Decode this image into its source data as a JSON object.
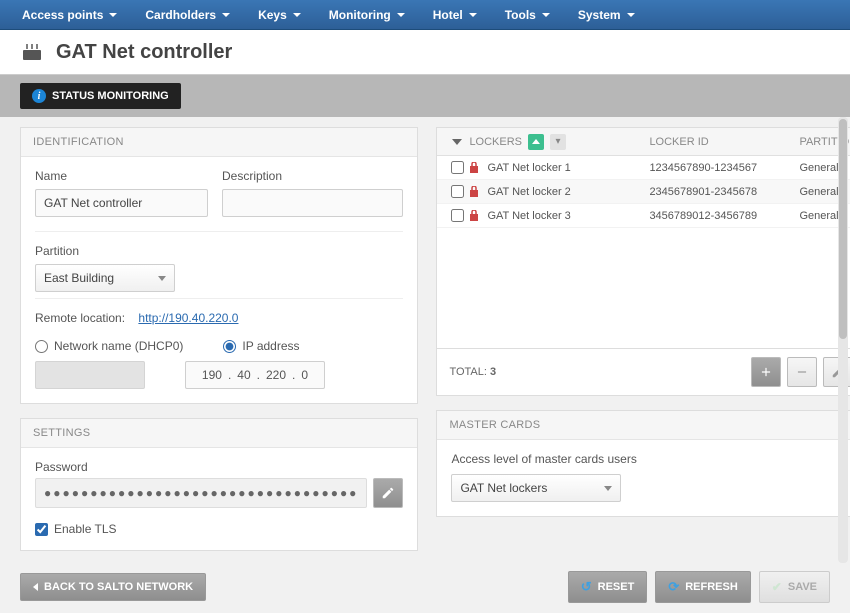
{
  "nav": [
    "Access points",
    "Cardholders",
    "Keys",
    "Monitoring",
    "Hotel",
    "Tools",
    "System"
  ],
  "page_title": "GAT Net controller",
  "status_button": "STATUS MONITORING",
  "identification": {
    "title": "IDENTIFICATION",
    "name_label": "Name",
    "name_value": "GAT Net controller",
    "desc_label": "Description",
    "desc_value": "",
    "partition_label": "Partition",
    "partition_value": "East Building",
    "remote_label": "Remote location:",
    "remote_url": "http://190.40.220.0",
    "radio_dhcp": "Network name (DHCP0)",
    "radio_ip": "IP address",
    "ip_parts": [
      "190",
      "40",
      "220",
      "0"
    ]
  },
  "settings": {
    "title": "SETTINGS",
    "password_label": "Password",
    "password_mask": "●●●●●●●●●●●●●●●●●●●●●●●●●●●●●●●●●●",
    "enable_tls": "Enable TLS"
  },
  "lockers": {
    "cols": {
      "lockers": "LOCKERS",
      "id": "LOCKER ID",
      "partition": "PARTITION"
    },
    "rows": [
      {
        "name": "GAT Net locker 1",
        "id": "1234567890-1234567",
        "partition": "General"
      },
      {
        "name": "GAT Net locker 2",
        "id": "2345678901-2345678",
        "partition": "General"
      },
      {
        "name": "GAT Net locker 3",
        "id": "3456789012-3456789",
        "partition": "General"
      }
    ],
    "total_label": "TOTAL:",
    "total_value": "3"
  },
  "master_cards": {
    "title": "MASTER CARDS",
    "access_label": "Access level of master cards users",
    "access_value": "GAT Net lockers"
  },
  "footer": {
    "back": "BACK TO SALTO NETWORK",
    "reset": "RESET",
    "refresh": "REFRESH",
    "save": "SAVE"
  }
}
